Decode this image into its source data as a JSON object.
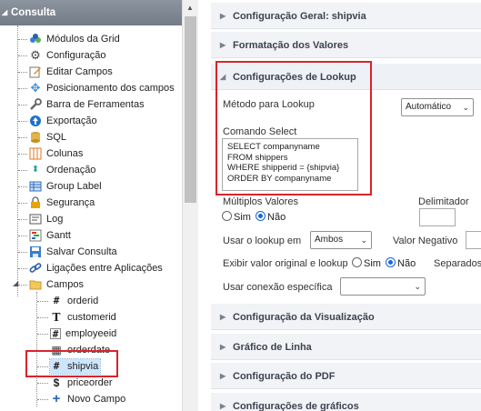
{
  "tree": {
    "title": "Consulta",
    "items": [
      {
        "label": "Módulos da Grid",
        "icon": "puzzle-icon"
      },
      {
        "label": "Configuração",
        "icon": "gear-icon"
      },
      {
        "label": "Editar Campos",
        "icon": "edit-icon"
      },
      {
        "label": "Posicionamento dos campos",
        "icon": "move-icon"
      },
      {
        "label": "Barra de Ferramentas",
        "icon": "wrench-icon"
      },
      {
        "label": "Exportação",
        "icon": "export-icon"
      },
      {
        "label": "SQL",
        "icon": "database-icon"
      },
      {
        "label": "Colunas",
        "icon": "columns-icon"
      },
      {
        "label": "Ordenação",
        "icon": "sort-icon"
      },
      {
        "label": "Group Label",
        "icon": "table-icon"
      },
      {
        "label": "Segurança",
        "icon": "lock-icon"
      },
      {
        "label": "Log",
        "icon": "log-icon"
      },
      {
        "label": "Gantt",
        "icon": "gantt-icon"
      },
      {
        "label": "Salvar Consulta",
        "icon": "save-icon"
      },
      {
        "label": "Ligações entre Aplicações",
        "icon": "link-icon"
      },
      {
        "label": "Campos",
        "icon": "folder-icon"
      }
    ],
    "fields": [
      {
        "label": "orderid",
        "icon": "#"
      },
      {
        "label": "customerid",
        "icon": "T"
      },
      {
        "label": "employeeid",
        "icon": "#"
      },
      {
        "label": "orderdate",
        "icon": "▦"
      },
      {
        "label": "shipvia",
        "icon": "#"
      },
      {
        "label": "priceorder",
        "icon": "$"
      },
      {
        "label": "Novo Campo",
        "icon": "+"
      }
    ]
  },
  "main": {
    "sections_top": [
      "Configuração Geral: shipvia",
      "Formatação dos Valores"
    ],
    "lookup": {
      "title": "Configurações de Lookup",
      "metodo_label": "Método para Lookup",
      "metodo_value": "Automático",
      "comando_label": "Comando Select",
      "sql": [
        "SELECT companyname",
        "FROM shippers",
        "WHERE shipperid = {shipvia}",
        "ORDER BY companyname"
      ],
      "multiplos_label": "Múltiplos Valores",
      "delimitador_label": "Delimitador",
      "sim": "Sim",
      "nao": "Não",
      "usar_lookup_label": "Usar o lookup em",
      "usar_lookup_value": "Ambos",
      "valor_negativo_label": "Valor Negativo",
      "exibir_label": "Exibir valor original e lookup",
      "separados_label": "Separados",
      "conexao_label": "Usar conexão específica",
      "conexao_value": ""
    },
    "sections_bottom": [
      "Configuração da Visualização",
      "Gráfico de Linha",
      "Configuração do PDF",
      "Configurações de gráficos"
    ]
  }
}
